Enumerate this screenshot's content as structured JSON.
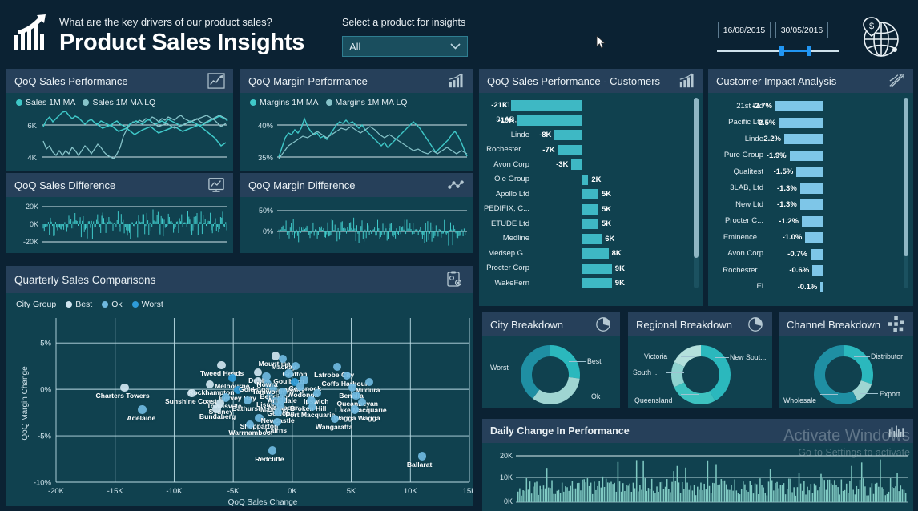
{
  "header": {
    "question": "What are the key drivers of our product sales?",
    "title": "Product Sales Insights",
    "logo_icon": "bar-chart-arrow-icon",
    "globe_icon": "globe-dollar-icon",
    "slicer": {
      "label": "Select a product for insights",
      "value": "All",
      "chevron": "chevron-down-icon"
    },
    "date_from": "16/08/2015",
    "date_to": "30/05/2016"
  },
  "panels": {
    "qoq_sales_performance": {
      "title": "QoQ Sales Performance",
      "icon": "line-chart-icon"
    },
    "qoq_sales_difference": {
      "title": "QoQ Sales Difference",
      "icon": "chart-monitor-icon"
    },
    "qoq_margin_performance": {
      "title": "QoQ Margin Performance",
      "icon": "bar-chart-icon"
    },
    "qoq_margin_difference": {
      "title": "QoQ Margin Difference",
      "icon": "scatter-link-icon"
    },
    "qoq_sales_customers": {
      "title": "QoQ Sales Performance - Customers",
      "icon": "bar-chart-icon"
    },
    "customer_impact": {
      "title": "Customer Impact Analysis",
      "icon": "ribbon-chart-icon"
    },
    "quarterly_comparisons": {
      "title": "Quarterly Sales Comparisons",
      "icon": "clipboard-gear-icon"
    },
    "city_breakdown": {
      "title": "City Breakdown",
      "icon": "pie-chart-icon"
    },
    "regional_breakdown": {
      "title": "Regional Breakdown",
      "icon": "pie-chart-icon"
    },
    "channel_breakdown": {
      "title": "Channel Breakdown",
      "icon": "network-nodes-icon"
    },
    "daily_change": {
      "title": "Daily Change In Performance",
      "icon": "column-chart-icon"
    }
  },
  "colors": {
    "page_bg": "#0b2233",
    "panel_bg": "#10414f",
    "panel_header": "#26405a",
    "teal": "#3fc8c8",
    "teal_light": "#8fd6d0",
    "blue": "#55b8e0",
    "blue_light": "#b4d9ea",
    "accent": "#2196f3"
  },
  "chart_data": [
    {
      "id": "qoq_sales_performance",
      "type": "line",
      "title": "QoQ Sales Performance",
      "legend": [
        {
          "name": "Sales 1M MA",
          "color": "#3fc8c8"
        },
        {
          "name": "Sales 1M MA LQ",
          "color": "#86c3c9"
        }
      ],
      "ylabel": "",
      "yticks": [
        "6K",
        "4K"
      ],
      "ylim": [
        3500,
        7000
      ],
      "grid": true,
      "series": [
        {
          "name": "Sales 1M MA",
          "values": [
            5000,
            4700,
            4900,
            4600,
            4400,
            4500,
            4300,
            4500,
            4400,
            4600,
            4500,
            4300,
            4500,
            4700,
            4600,
            4400,
            4600,
            4800,
            4700,
            4500,
            4300,
            4200,
            4100,
            4300,
            4600,
            5200,
            5600,
            5900,
            6100,
            6000,
            6200,
            6100,
            6300,
            6200,
            6400,
            6300,
            6100,
            6300,
            6200,
            6400,
            6300,
            6200,
            6400,
            6500,
            6300,
            6200,
            6100,
            6200,
            6300,
            6100,
            6000,
            6100,
            6200,
            6300,
            6400,
            6500,
            6400,
            6300,
            6200,
            6100,
            6300,
            6400,
            6300,
            6200,
            6300,
            6400,
            6500,
            6300,
            6200,
            6100,
            6200,
            6300,
            6400,
            6300,
            6200,
            6100,
            6000,
            5900,
            6000,
            6100,
            6200,
            6100,
            6000,
            5900,
            5800,
            5900,
            6000,
            6100,
            6000,
            5900,
            5800,
            5700,
            5600,
            5500,
            5600,
            5700,
            5800,
            5700,
            5600,
            5500
          ]
        },
        {
          "name": "Sales 1M MA LQ",
          "values": [
            5900,
            6200,
            6400,
            6100,
            6300,
            6500,
            6800,
            6900,
            6600,
            6400,
            6600,
            6500,
            6300,
            6100,
            6300,
            6400,
            6200,
            6100,
            6300,
            6200,
            6100,
            6000,
            6200,
            6300,
            6100,
            6000,
            5900,
            6100,
            6200,
            6300,
            6200,
            6100,
            6300,
            6400,
            6200,
            6100,
            6200,
            6300,
            6200,
            6400,
            6300,
            6200,
            6100,
            6000,
            6100,
            6200,
            6300,
            6200,
            6100,
            6000,
            5900,
            6000,
            6100,
            6200,
            6300,
            6400,
            6500,
            6600,
            6500,
            6400,
            6300,
            6200,
            6300,
            6400,
            6500,
            6600,
            6700,
            6600,
            6500,
            6400,
            6300,
            6200,
            6100,
            6000,
            5900,
            5800,
            5700,
            5600,
            5500,
            5400,
            5300,
            5200,
            5400,
            5600,
            5800,
            6000,
            6100,
            6200,
            6100,
            6000,
            5900,
            6000,
            6100,
            6200,
            6100,
            6000,
            5900,
            5800,
            6000,
            6100
          ]
        }
      ]
    },
    {
      "id": "qoq_sales_difference",
      "type": "bar",
      "title": "QoQ Sales Difference",
      "yticks": [
        "20K",
        "0K",
        "-20K"
      ],
      "ylim": [
        -20000,
        20000
      ],
      "grid": true,
      "values_note": "dense daily difference bars oscillating around 0K, range approx -20K to +20K"
    },
    {
      "id": "qoq_margin_performance",
      "type": "line",
      "title": "QoQ Margin Performance",
      "legend": [
        {
          "name": "Margins 1M MA",
          "color": "#3fc8c8"
        },
        {
          "name": "Margins 1M MA LQ",
          "color": "#86c3c9"
        }
      ],
      "yticks": [
        "40%",
        "35%"
      ],
      "ylim": [
        34,
        42
      ],
      "grid": true
    },
    {
      "id": "qoq_margin_difference",
      "type": "bar",
      "title": "QoQ Margin Difference",
      "yticks": [
        "50%",
        "0%"
      ],
      "ylim": [
        -25,
        55
      ],
      "grid": true
    },
    {
      "id": "qoq_sales_customers",
      "type": "bar",
      "orientation": "horizontal",
      "title": "QoQ Sales Performance - Customers",
      "categories": [
        "21st Ltd",
        "3LAB, Ltd",
        "Linde",
        "Rochester ...",
        "Avon Corp",
        "Ole Group",
        "Apollo Ltd",
        "PEDIFIX, C...",
        "ETUDE Ltd",
        "Medline",
        "Medsep G...",
        "Procter Corp",
        "WakeFern"
      ],
      "labels": [
        "-21K",
        "-19K",
        "-8K",
        "-7K",
        "-3K",
        "2K",
        "5K",
        "5K",
        "5K",
        "6K",
        "8K",
        "9K",
        "9K"
      ],
      "values": [
        -21000,
        -19000,
        -8000,
        -7000,
        -3000,
        2000,
        5000,
        5000,
        5000,
        6000,
        8000,
        9000,
        9000
      ],
      "bar_color": "#3eb8c4"
    },
    {
      "id": "customer_impact",
      "type": "bar",
      "orientation": "horizontal",
      "title": "Customer Impact Analysis",
      "categories": [
        "21st Ltd",
        "Pacific Ltd",
        "Linde",
        "Pure Group",
        "Qualitest",
        "3LAB, Ltd",
        "New Ltd",
        "Procter C...",
        "Eminence...",
        "Avon Corp",
        "Rochester...",
        "Ei"
      ],
      "labels": [
        "-2.7%",
        "-2.5%",
        "-2.2%",
        "-1.9%",
        "-1.5%",
        "-1.3%",
        "-1.3%",
        "-1.2%",
        "-1.0%",
        "-0.7%",
        "-0.6%",
        "-0.1%"
      ],
      "values": [
        -2.7,
        -2.5,
        -2.2,
        -1.9,
        -1.5,
        -1.3,
        -1.3,
        -1.2,
        -1.0,
        -0.7,
        -0.6,
        -0.1
      ],
      "bar_color": "#7ec6e8"
    },
    {
      "id": "quarterly_comparisons",
      "type": "scatter",
      "title": "Quarterly Sales Comparisons",
      "legend_title": "City Group",
      "legend": [
        {
          "name": "Best",
          "color": "#cfe5f0"
        },
        {
          "name": "Ok",
          "color": "#6fb9e0"
        },
        {
          "name": "Worst",
          "color": "#2e9bd8"
        }
      ],
      "xlabel": "QoQ Sales Change",
      "ylabel": "QoQ Margin Change",
      "xticks": [
        "-20K",
        "-15K",
        "-10K",
        "-5K",
        "0K",
        "5K",
        "10K",
        "15K"
      ],
      "yticks": [
        "5%",
        "0%",
        "-5%",
        "-10%"
      ],
      "xlim": [
        -20000,
        15000
      ],
      "ylim": [
        -10,
        7
      ],
      "grid": true,
      "points": [
        {
          "label": "Charters Towers",
          "x": -14200,
          "y": 0.2,
          "group": "Best"
        },
        {
          "label": "Adelaide",
          "x": -12700,
          "y": -2.2,
          "group": "Ok"
        },
        {
          "label": "Tweed Heads",
          "x": -6000,
          "y": 2.6,
          "group": "Best"
        },
        {
          "label": "Melbourne",
          "x": -5100,
          "y": 1.2,
          "group": "Worst"
        },
        {
          "label": "Rockhampton",
          "x": -7000,
          "y": 0.5,
          "group": "Best"
        },
        {
          "label": "Sunshine Coast",
          "x": -8500,
          "y": -0.4,
          "group": "Best"
        },
        {
          "label": "Hervey Bay",
          "x": -4600,
          "y": -0.1,
          "group": "Worst"
        },
        {
          "label": "Townsville",
          "x": -5600,
          "y": -0.9,
          "group": "Ok"
        },
        {
          "label": "Sydney",
          "x": -6100,
          "y": -1.5,
          "group": "Best"
        },
        {
          "label": "Bundaberg",
          "x": -6400,
          "y": -2.1,
          "group": "Best"
        },
        {
          "label": "Bathurst",
          "x": -3800,
          "y": -1.2,
          "group": "Ok"
        },
        {
          "label": "Dubbo",
          "x": -2900,
          "y": 1.8,
          "group": "Best"
        },
        {
          "label": "Gold Coast",
          "x": -2900,
          "y": 0.9,
          "group": "Best"
        },
        {
          "label": "Lismore",
          "x": -1900,
          "y": -0.8,
          "group": "Ok"
        },
        {
          "label": "Bendigo",
          "x": -1600,
          "y": 0.1,
          "group": "Ok"
        },
        {
          "label": "Tamworth",
          "x": -2100,
          "y": 0.6,
          "group": "Ok"
        },
        {
          "label": "Maitland",
          "x": -1400,
          "y": -1.3,
          "group": "Ok"
        },
        {
          "label": "Shepparton",
          "x": -2800,
          "y": -3.1,
          "group": "Ok"
        },
        {
          "label": "Warrnambool",
          "x": -3600,
          "y": -3.8,
          "group": "Ok"
        },
        {
          "label": "Mount Isa",
          "x": -1400,
          "y": 3.6,
          "group": "Best"
        },
        {
          "label": "Mackay",
          "x": -800,
          "y": 3.3,
          "group": "Ok"
        },
        {
          "label": "Grafton",
          "x": 300,
          "y": 2.5,
          "group": "Ok"
        },
        {
          "label": "Goulburn",
          "x": -300,
          "y": 1.7,
          "group": "Ok"
        },
        {
          "label": "Nowra",
          "x": -2200,
          "y": 1.4,
          "group": "Ok"
        },
        {
          "label": "Albury",
          "x": 200,
          "y": 0.8,
          "group": "Worst"
        },
        {
          "label": "Cessnock",
          "x": 1000,
          "y": 1.0,
          "group": "Ok"
        },
        {
          "label": "Wodonga",
          "x": 700,
          "y": 0.3,
          "group": "Ok"
        },
        {
          "label": "Armidale",
          "x": -800,
          "y": -0.3,
          "group": "Ok"
        },
        {
          "label": "Nambour",
          "x": -900,
          "y": -1.1,
          "group": "Ok"
        },
        {
          "label": "Geelong",
          "x": -1000,
          "y": -1.7,
          "group": "Ok"
        },
        {
          "label": "Newcastle",
          "x": -1200,
          "y": -2.5,
          "group": "Ok"
        },
        {
          "label": "Cairns",
          "x": -1300,
          "y": -3.5,
          "group": "Ok"
        },
        {
          "label": "Ipswich",
          "x": 2100,
          "y": -0.4,
          "group": "Ok"
        },
        {
          "label": "Broken Hill",
          "x": 1600,
          "y": -1.2,
          "group": "Ok"
        },
        {
          "label": "Port Macquarie",
          "x": 1700,
          "y": -1.9,
          "group": "Ok"
        },
        {
          "label": "Latrobe City",
          "x": 3800,
          "y": 2.4,
          "group": "Ok"
        },
        {
          "label": "Coffs Harbour",
          "x": 4600,
          "y": 1.5,
          "group": "Ok"
        },
        {
          "label": "Benalla",
          "x": 5100,
          "y": 0.2,
          "group": "Ok"
        },
        {
          "label": "Mildura",
          "x": 6500,
          "y": 0.8,
          "group": "Ok"
        },
        {
          "label": "Queanbeyan",
          "x": 5400,
          "y": -0.7,
          "group": "Ok"
        },
        {
          "label": "Lake Macquarie",
          "x": 5900,
          "y": -1.4,
          "group": "Ok"
        },
        {
          "label": "Wagga Wagga",
          "x": 5300,
          "y": -2.2,
          "group": "Ok"
        },
        {
          "label": "Wangaratta",
          "x": 3600,
          "y": -3.2,
          "group": "Ok"
        },
        {
          "label": "Redcliffe",
          "x": -1700,
          "y": -6.6,
          "group": "Ok"
        },
        {
          "label": "Ballarat",
          "x": 11000,
          "y": -7.2,
          "group": "Ok"
        }
      ]
    },
    {
      "id": "city_breakdown",
      "type": "pie",
      "title": "City Breakdown",
      "labels": [
        "Best",
        "Ok",
        "Worst"
      ],
      "values": [
        27,
        33,
        40
      ],
      "colors": [
        "#2bb8bd",
        "#9fd5d2",
        "#1f8fa3"
      ],
      "legend_position": "callout"
    },
    {
      "id": "regional_breakdown",
      "type": "pie",
      "title": "Regional Breakdown",
      "labels": [
        "New Sout...",
        "Queensland",
        "South ...",
        "Victoria"
      ],
      "values": [
        42,
        26,
        14,
        18
      ],
      "colors": [
        "#2bb8bd",
        "#3dc2c0",
        "#8ed2cf",
        "#b4e0dc"
      ],
      "legend_position": "callout"
    },
    {
      "id": "channel_breakdown",
      "type": "pie",
      "title": "Channel Breakdown",
      "labels": [
        "Distributor",
        "Export",
        "Wholesale"
      ],
      "values": [
        30,
        12,
        58
      ],
      "colors": [
        "#2bb8bd",
        "#9fd5d2",
        "#1f8fa3"
      ],
      "legend_position": "callout"
    },
    {
      "id": "daily_change",
      "type": "bar",
      "title": "Daily Change In Performance",
      "yticks": [
        "20K",
        "10K",
        "0K"
      ],
      "ylim": [
        0,
        22000
      ],
      "grid": true,
      "bar_color": "#7fc9c2",
      "values_note": "dense daily columns mostly 2K-10K with occasional spikes near 15K-17K"
    }
  ],
  "watermark": {
    "line1": "Activate Windows",
    "line2": "Go to Settings to activate"
  }
}
